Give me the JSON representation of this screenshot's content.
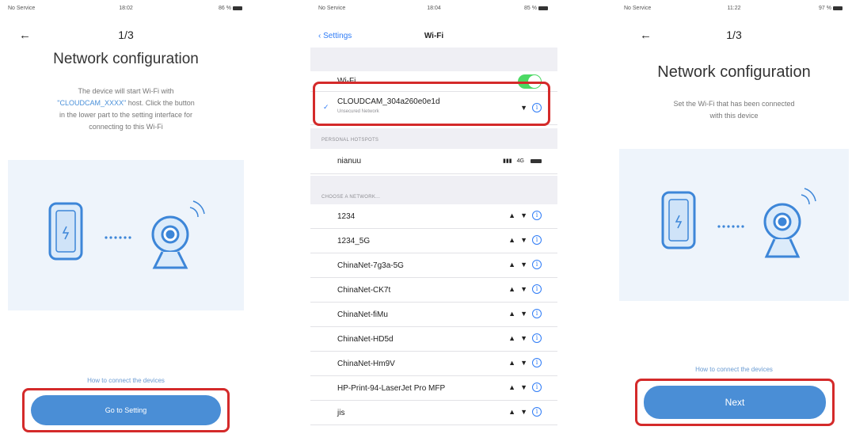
{
  "screen1": {
    "status": {
      "carrier": "No Service",
      "time": "18:02",
      "battery": "86 %"
    },
    "back_icon": "arrow-left-icon",
    "step": "1/3",
    "title": "Network configuration",
    "desc_line1": "The device will start Wi-Fi with",
    "desc_hl": "\"CLOUDCAM_XXXX\"",
    "desc_after": " host. Click the button",
    "desc_line3": "in the lower part to the setting interface for",
    "desc_line4": "connecting to this Wi-Fi",
    "help": "How to connect the devices",
    "button": "Go to Setting"
  },
  "screen2": {
    "status": {
      "carrier": "No Service",
      "time": "18:04",
      "battery": "85 %"
    },
    "back": "Settings",
    "nav_title": "Wi-Fi",
    "wifi_label": "Wi-Fi",
    "connected_name": "CLOUDCAM_304a260e0e1d",
    "connected_sub": "Unsecured Network",
    "personal_hotspots": "PERSONAL HOTSPOTS",
    "hotspot_name": "nianuu",
    "hotspot_signal": "4G",
    "choose_network": "CHOOSE A NETWORK...",
    "networks": [
      "1234",
      "1234_5G",
      "ChinaNet-7g3a-5G",
      "ChinaNet-CK7t",
      "ChinaNet-fiMu",
      "ChinaNet-HD5d",
      "ChinaNet-Hm9V",
      "HP-Print-94-LaserJet Pro MFP",
      "jis"
    ]
  },
  "screen3": {
    "status": {
      "carrier": "No Service",
      "time": "11:22",
      "battery": "97 %"
    },
    "back_icon": "arrow-left-icon",
    "step": "1/3",
    "title": "Network configuration",
    "desc_line1": "Set the Wi-Fi that has been connected",
    "desc_line2": "with this device",
    "help": "How to connect the devices",
    "button": "Next"
  },
  "colors": {
    "accent": "#4a8ed6",
    "highlight": "#d42a2a",
    "toggle": "#4cd964",
    "ios_blue": "#2f7cf6"
  }
}
